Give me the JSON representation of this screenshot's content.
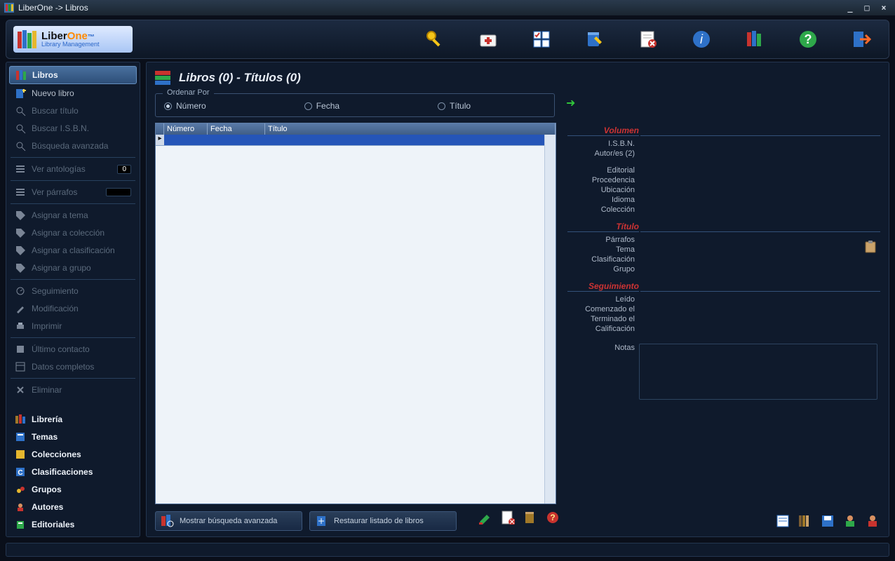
{
  "window": {
    "title": "LiberOne  ->  Libros"
  },
  "logo": {
    "line1a": "Liber",
    "line1b": "One",
    "tm": "™",
    "line2": "Library Management"
  },
  "toolbar_icons": [
    {
      "name": "key-icon"
    },
    {
      "name": "medkit-icon"
    },
    {
      "name": "checklist-icon"
    },
    {
      "name": "book-edit-icon"
    },
    {
      "name": "sheet-delete-icon"
    },
    {
      "name": "info-icon"
    },
    {
      "name": "books-icon"
    },
    {
      "name": "help-icon"
    },
    {
      "name": "exit-icon"
    }
  ],
  "sidebar": {
    "selected": "Libros",
    "items": [
      {
        "label": "Libros",
        "icon": "books",
        "selected": true,
        "bold": true
      },
      {
        "label": "Nuevo libro",
        "icon": "book-plus",
        "bold": false
      },
      {
        "label": "Buscar título",
        "icon": "search",
        "disabled": true
      },
      {
        "label": "Buscar I.S.B.N.",
        "icon": "search",
        "disabled": true
      },
      {
        "label": "Búsqueda avanzada",
        "icon": "search",
        "disabled": true
      },
      {
        "sep": true
      },
      {
        "label": "Ver antologías",
        "icon": "list",
        "disabled": true,
        "badge": "0"
      },
      {
        "sep": true
      },
      {
        "label": "Ver párrafos",
        "icon": "list",
        "disabled": true,
        "slot": true
      },
      {
        "sep": true
      },
      {
        "label": "Asignar a tema",
        "icon": "tag",
        "disabled": true
      },
      {
        "label": "Asignar a colección",
        "icon": "tag",
        "disabled": true
      },
      {
        "label": "Asignar a clasificación",
        "icon": "tag",
        "disabled": true
      },
      {
        "label": "Asignar a grupo",
        "icon": "tag",
        "disabled": true
      },
      {
        "sep": true
      },
      {
        "label": "Seguimiento",
        "icon": "track",
        "disabled": true
      },
      {
        "label": "Modificación",
        "icon": "edit",
        "disabled": true
      },
      {
        "label": "Imprimir",
        "icon": "print",
        "disabled": true
      },
      {
        "sep": true
      },
      {
        "label": "Último contacto",
        "icon": "contact",
        "disabled": true
      },
      {
        "label": "Datos completos",
        "icon": "data",
        "disabled": true
      },
      {
        "sep": true
      },
      {
        "label": "Eliminar",
        "icon": "delete",
        "disabled": true
      }
    ],
    "nav": [
      {
        "label": "Librería",
        "icon": "library"
      },
      {
        "label": "Temas",
        "icon": "topics"
      },
      {
        "label": "Colecciones",
        "icon": "collections"
      },
      {
        "label": "Clasificaciones",
        "icon": "classifications"
      },
      {
        "label": "Grupos",
        "icon": "groups"
      },
      {
        "label": "Autores",
        "icon": "authors"
      },
      {
        "label": "Editoriales",
        "icon": "publishers"
      }
    ]
  },
  "content": {
    "title": "Libros (0) - Títulos (0)",
    "sort": {
      "legend": "Ordenar Por",
      "options": [
        {
          "label": "Número",
          "checked": true
        },
        {
          "label": "Fecha",
          "checked": false
        },
        {
          "label": "Título",
          "checked": false
        }
      ]
    },
    "grid": {
      "columns": [
        "Número",
        "Fecha",
        "Título"
      ],
      "rows": []
    },
    "bottom_buttons": [
      {
        "label": "Mostrar búsqueda avanzada",
        "icon": "search-adv"
      },
      {
        "label": "Restaurar listado de libros",
        "icon": "restore"
      }
    ],
    "tools_left": [
      "edit-icon",
      "sheet-delete-icon",
      "book-icon",
      "help-small-icon"
    ],
    "tools_right": [
      "form-icon",
      "shelf-icon",
      "save-icon",
      "user-icon",
      "person-icon"
    ]
  },
  "details": {
    "sections": [
      {
        "title": "Volumen",
        "fields": [
          {
            "label": "I.S.B.N."
          },
          {
            "label": "Autor/es  (2)"
          },
          {
            "spacer": true
          },
          {
            "label": "Editorial"
          },
          {
            "label": "Procedencia"
          },
          {
            "label": "Ubicación"
          },
          {
            "label": "Idioma"
          },
          {
            "label": "Colección"
          }
        ]
      },
      {
        "title": "Título",
        "fields": [
          {
            "label": "Párrafos"
          },
          {
            "label": "Tema"
          },
          {
            "label": "Clasificación"
          },
          {
            "label": "Grupo"
          }
        ]
      },
      {
        "title": "Seguimiento",
        "fields": [
          {
            "label": "Leído"
          },
          {
            "label": "Comenzado el"
          },
          {
            "label": "Terminado el"
          },
          {
            "label": "Calificación"
          },
          {
            "spacer": true
          },
          {
            "label": "Notas",
            "notes": true
          }
        ]
      }
    ]
  }
}
